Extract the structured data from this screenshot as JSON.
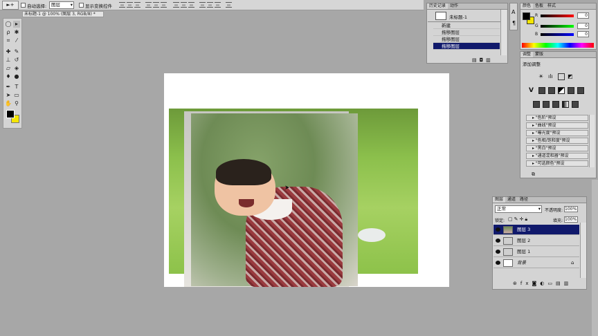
{
  "options_bar": {
    "auto_select_label": "自动选择:",
    "auto_select_value": "图层",
    "show_transform_label": "显示变换控件"
  },
  "document_tab": {
    "title": "未标题-1 @ 100% (图层 3, RGB/8) *"
  },
  "history_panel": {
    "tabs": [
      "历史记录",
      "动作"
    ],
    "snapshot_label": "未标题-1",
    "items": [
      "新建",
      "拖移图层",
      "拖移图层",
      "拖移图层"
    ],
    "active_index": 3
  },
  "color_panel": {
    "tabs": [
      "颜色",
      "色板",
      "样式"
    ],
    "channels": [
      {
        "label": "R",
        "value": "0",
        "color": "#e03030"
      },
      {
        "label": "G",
        "value": "0",
        "color": "#30a030"
      },
      {
        "label": "B",
        "value": "0",
        "color": "#3050d0"
      }
    ],
    "foreground": "#000000",
    "background": "#f5e600"
  },
  "adjustments_panel": {
    "tabs": [
      "调整",
      "蒙版"
    ],
    "title": "添加调整",
    "presets": [
      "\"色阶\"预设",
      "\"曲线\"预设",
      "\"曝光度\"预设",
      "\"色相/饱和度\"预设",
      "\"黑白\"预设",
      "\"通道混和器\"预设",
      "\"可选颜色\"预设"
    ]
  },
  "layers_panel": {
    "tabs": [
      "图层",
      "通道",
      "路径"
    ],
    "blend_mode": "正常",
    "opacity_label": "不透明度:",
    "opacity_value": "100%",
    "lock_label": "锁定:",
    "fill_label": "填充:",
    "fill_value": "100%",
    "layers": [
      {
        "name": "图层 3",
        "active": true
      },
      {
        "name": "图层 2",
        "active": false
      },
      {
        "name": "图层 1",
        "active": false
      },
      {
        "name": "背景",
        "active": false,
        "italic": true
      }
    ]
  },
  "toolbox": {
    "icons": [
      "marquee-icon",
      "move-icon",
      "lasso-icon",
      "magic-wand-icon",
      "crop-icon",
      "eyedropper-icon",
      "heal-icon",
      "brush-icon",
      "stamp-icon",
      "history-brush-icon",
      "eraser-icon",
      "gradient-icon",
      "blur-icon",
      "dodge-icon",
      "pen-icon",
      "type-icon",
      "path-select-icon",
      "shape-icon",
      "hand-icon",
      "zoom-icon"
    ]
  }
}
